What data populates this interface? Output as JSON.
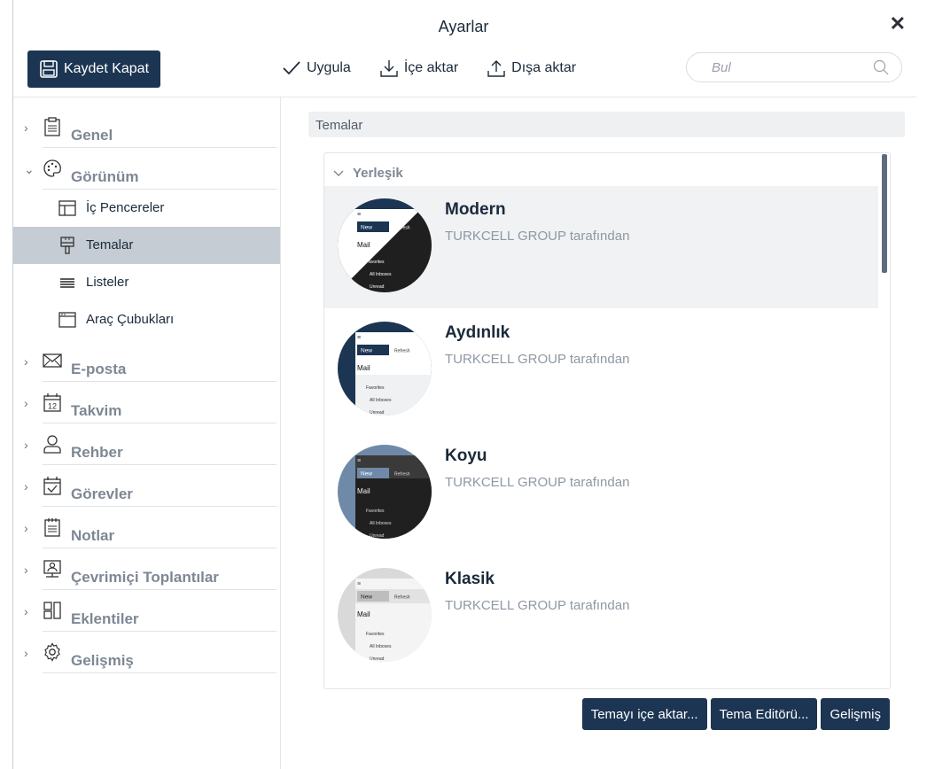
{
  "window": {
    "title": "Ayarlar"
  },
  "toolbar": {
    "save_label": "Kaydet  Kapat",
    "apply_label": "Uygula",
    "import_label": "İçe aktar",
    "export_label": "Dışa aktar"
  },
  "search": {
    "placeholder": "Bul"
  },
  "sidebar": {
    "items": [
      {
        "label": "Genel",
        "icon": "clipboard-icon"
      },
      {
        "label": "Görünüm",
        "icon": "palette-icon",
        "expanded": true,
        "children": [
          {
            "label": "İç Pencereler",
            "icon": "layout-icon"
          },
          {
            "label": "Temalar",
            "icon": "brush-icon",
            "active": true
          },
          {
            "label": "Listeler",
            "icon": "list-icon"
          },
          {
            "label": "Araç Çubukları",
            "icon": "window-icon"
          }
        ]
      },
      {
        "label": "E-posta",
        "icon": "envelope-icon"
      },
      {
        "label": "Takvim",
        "icon": "calendar-icon",
        "badge": "12"
      },
      {
        "label": "Rehber",
        "icon": "person-icon"
      },
      {
        "label": "Görevler",
        "icon": "task-icon"
      },
      {
        "label": "Notlar",
        "icon": "note-icon"
      },
      {
        "label": "Çevrimiçi Toplantılar",
        "icon": "meeting-icon"
      },
      {
        "label": "Eklentiler",
        "icon": "addons-icon"
      },
      {
        "label": "Gelişmiş",
        "icon": "gear-icon"
      }
    ]
  },
  "content": {
    "section_title": "Temalar",
    "group_title": "Yerleşik",
    "themes": [
      {
        "name": "Modern",
        "author": "TURKCELL GROUP tarafından",
        "selected": true
      },
      {
        "name": "Aydınlık",
        "author": "TURKCELL GROUP tarafından"
      },
      {
        "name": "Koyu",
        "author": "TURKCELL GROUP tarafından"
      },
      {
        "name": "Klasik",
        "author": "TURKCELL GROUP tarafından"
      }
    ],
    "thumb_text": {
      "new": "New",
      "refresh": "Refresh",
      "mail": "Mail",
      "favorites": "Favorites",
      "all_inboxes": "All Inboxes",
      "unread": "Unread"
    },
    "buttons": {
      "import_theme": "Temayı içe aktar...",
      "theme_editor": "Tema Editörü...",
      "advanced": "Gelişmiş"
    }
  },
  "colors": {
    "accent": "#1c3553",
    "active_row": "#c5ccd3",
    "muted_text": "#7e8794"
  }
}
